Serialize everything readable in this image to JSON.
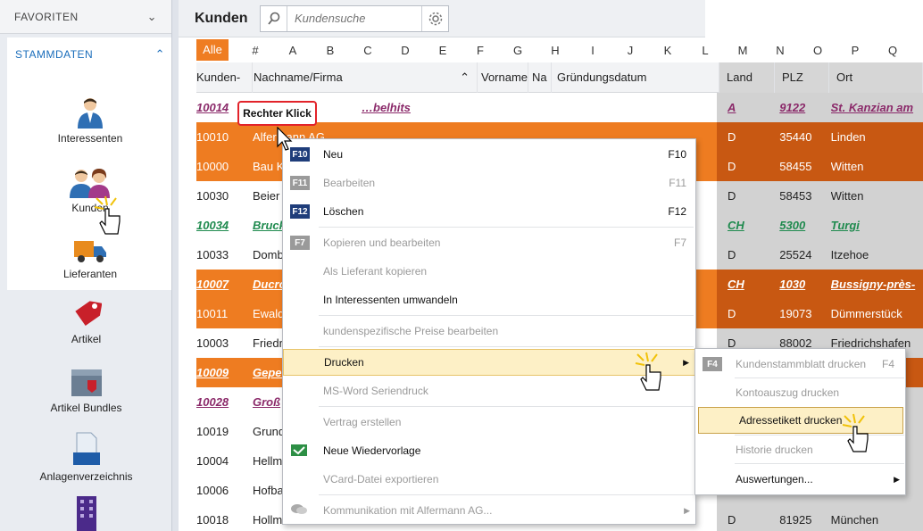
{
  "sidebar": {
    "favoriten": "FAVORITEN",
    "stammdaten": "STAMMDATEN",
    "items": [
      {
        "label": "Interessenten",
        "icon": "person-icon"
      },
      {
        "label": "Kunden",
        "icon": "customers-icon"
      },
      {
        "label": "Lieferanten",
        "icon": "delivery-truck-icon"
      },
      {
        "label": "Artikel",
        "icon": "tag-icon"
      },
      {
        "label": "Artikel Bundles",
        "icon": "bundle-box-icon"
      },
      {
        "label": "Anlagenverzeichnis",
        "icon": "asset-directory-icon"
      },
      {
        "label": "",
        "icon": "building-icon"
      }
    ]
  },
  "header": {
    "title": "Kunden",
    "search_placeholder": "Kundensuche"
  },
  "alpha_filter": [
    "Alle",
    "#",
    "A",
    "B",
    "C",
    "D",
    "E",
    "F",
    "G",
    "H",
    "I",
    "J",
    "K",
    "L",
    "M",
    "N",
    "O",
    "P",
    "Q"
  ],
  "table": {
    "columns": [
      "Kunden-",
      "Nachname/Firma",
      "Vorname",
      "Na",
      "Gründungsdatum",
      "Land",
      "PLZ",
      "Ort"
    ],
    "rows": [
      {
        "nr": "10014",
        "name": "…belhits",
        "land": "A",
        "plz": "9122",
        "ort": "St. Kanzian am",
        "style": "pink-link"
      },
      {
        "nr": "10010",
        "name": "Alfermann AG",
        "land": "D",
        "plz": "35440",
        "ort": "Linden",
        "style": "orange"
      },
      {
        "nr": "10000",
        "name": "Bau K",
        "land": "D",
        "plz": "58455",
        "ort": "Witten",
        "style": "orange"
      },
      {
        "nr": "10030",
        "name": "Beier",
        "land": "D",
        "plz": "58453",
        "ort": "Witten",
        "style": "plain"
      },
      {
        "nr": "10034",
        "name": "Bruck",
        "land": "CH",
        "plz": "5300",
        "ort": "Turgi",
        "style": "green-link"
      },
      {
        "nr": "10033",
        "name": "Domb",
        "land": "D",
        "plz": "25524",
        "ort": "Itzehoe",
        "style": "plain"
      },
      {
        "nr": "10007",
        "name": "Ducro",
        "land": "CH",
        "plz": "1030",
        "ort": "Bussigny-près-",
        "style": "orange-link"
      },
      {
        "nr": "10011",
        "name": "Ewald",
        "land": "D",
        "plz": "19073",
        "ort": "Dümmerstück",
        "style": "orange"
      },
      {
        "nr": "10003",
        "name": "Friedr",
        "land": "D",
        "plz": "88002",
        "ort": "Friedrichshafen",
        "style": "plain"
      },
      {
        "nr": "10009",
        "name": "Gepet",
        "land": "",
        "plz": "",
        "ort": "",
        "style": "orange-link"
      },
      {
        "nr": "10028",
        "name": "Groß",
        "land": "",
        "plz": "",
        "ort": "",
        "style": "pink-link"
      },
      {
        "nr": "10019",
        "name": "Grund",
        "land": "",
        "plz": "",
        "ort": "",
        "style": "plain"
      },
      {
        "nr": "10004",
        "name": "Hellm",
        "land": "",
        "plz": "",
        "ort": "",
        "style": "plain"
      },
      {
        "nr": "10006",
        "name": "Hofba",
        "land": "",
        "plz": "",
        "ort": "",
        "style": "plain"
      },
      {
        "nr": "10018",
        "name": "Hollm",
        "land": "D",
        "plz": "81925",
        "ort": "München",
        "style": "plain"
      }
    ]
  },
  "tooltip": "Rechter Klick",
  "context_menu": [
    {
      "key": "F10",
      "label": "Neu",
      "shortcut": "F10",
      "disabled": false
    },
    {
      "key": "F11",
      "label": "Bearbeiten",
      "shortcut": "F11",
      "disabled": true
    },
    {
      "key": "F12",
      "label": "Löschen",
      "shortcut": "F12",
      "disabled": false
    },
    {
      "key": "F7",
      "label": "Kopieren und bearbeiten",
      "shortcut": "F7",
      "disabled": true
    },
    {
      "key": "",
      "label": "Als Lieferant kopieren",
      "shortcut": "",
      "disabled": true
    },
    {
      "key": "",
      "label": "In Interessenten umwandeln",
      "shortcut": "",
      "disabled": false
    },
    {
      "key": "",
      "label": "kundenspezifische Preise bearbeiten",
      "shortcut": "",
      "disabled": true
    },
    {
      "key": "",
      "label": "Drucken",
      "shortcut": "",
      "disabled": false
    },
    {
      "key": "",
      "label": "MS-Word Seriendruck",
      "shortcut": "",
      "disabled": true
    },
    {
      "key": "",
      "label": "Vertrag erstellen",
      "shortcut": "",
      "disabled": true
    },
    {
      "key": "",
      "label": "Neue Wiedervorlage",
      "shortcut": "",
      "disabled": false
    },
    {
      "key": "",
      "label": "VCard-Datei exportieren",
      "shortcut": "",
      "disabled": true
    },
    {
      "key": "",
      "label": "Kommunikation mit Alfermann AG...",
      "shortcut": "",
      "disabled": true
    }
  ],
  "submenu": [
    {
      "key": "F4",
      "label": "Kundenstammblatt drucken",
      "shortcut": "F4",
      "disabled": true
    },
    {
      "label": "Kontoauszug drucken",
      "disabled": true
    },
    {
      "label": "Adressetikett drucken",
      "disabled": false
    },
    {
      "label": "Historie drucken",
      "disabled": true
    },
    {
      "label": "Auswertungen...",
      "disabled": false
    }
  ],
  "colors": {
    "accent": "#ef7d22",
    "brand_blue": "#1a6dbb",
    "highlight": "#fdf0c6"
  }
}
